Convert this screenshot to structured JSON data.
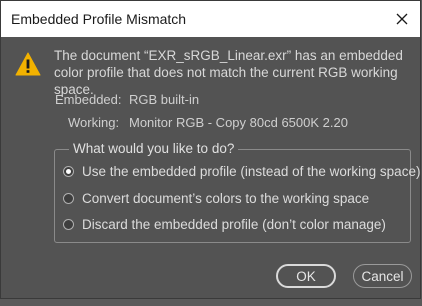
{
  "dialog": {
    "title": "Embedded Profile Mismatch",
    "message": "The document “EXR_sRGB_Linear.exr” has an embedded color profile that does not match the current RGB working space.",
    "embedded_label": "Embedded:",
    "embedded_value": "RGB built-in",
    "working_label": "Working:",
    "working_value": "Monitor RGB - Copy 80cd 6500K 2.20",
    "question": "What would you like to do?",
    "options": [
      {
        "label": "Use the embedded profile (instead of the working space)",
        "selected": true
      },
      {
        "label": "Convert document’s colors to the working space",
        "selected": false
      },
      {
        "label": "Discard the embedded profile (don’t color manage)",
        "selected": false
      }
    ],
    "ok_label": "OK",
    "cancel_label": "Cancel",
    "icons": {
      "close": "close-icon",
      "warning": "warning-icon"
    },
    "colors": {
      "warning": "#f2b200",
      "background": "#535353",
      "titlebar": "#ffffff"
    }
  }
}
